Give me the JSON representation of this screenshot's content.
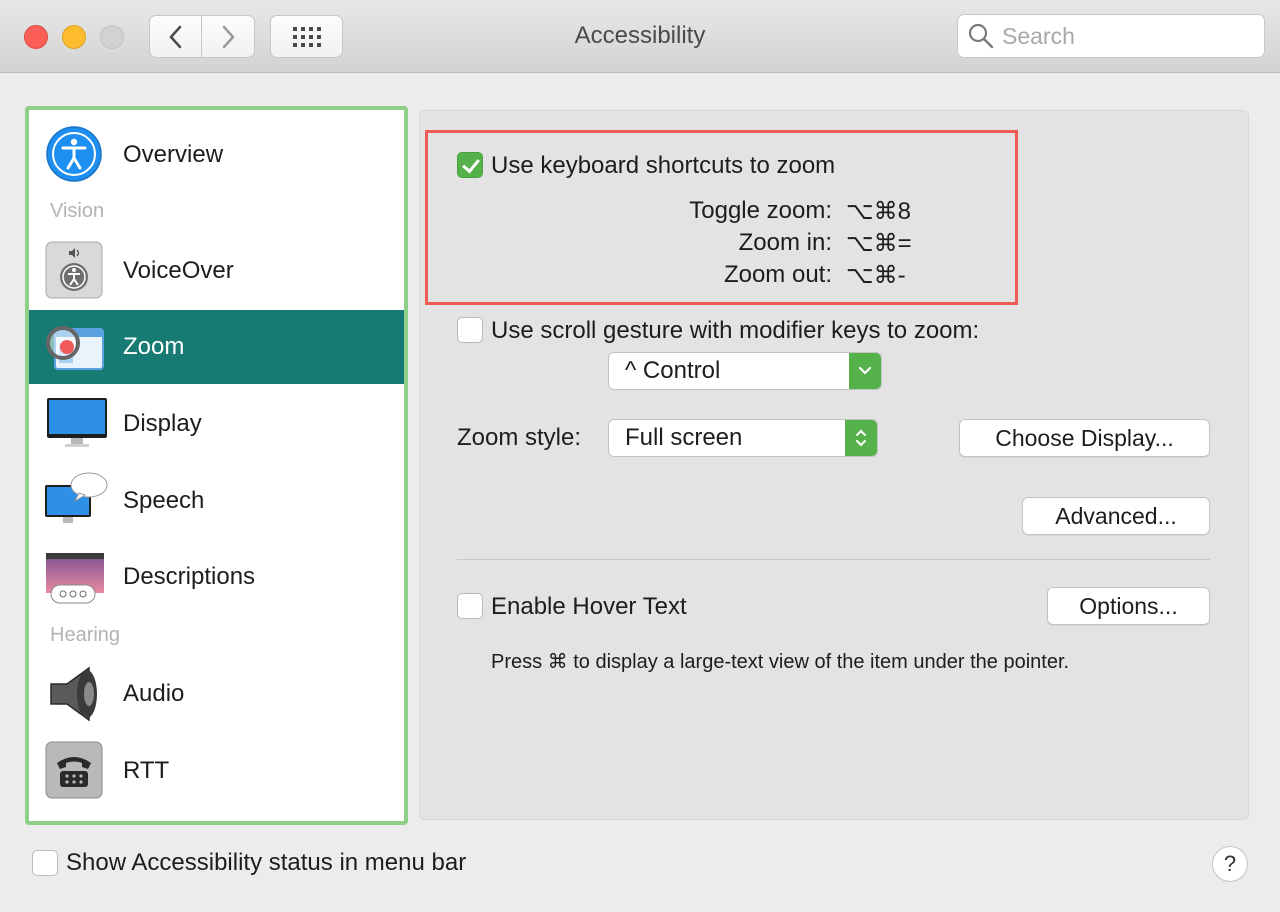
{
  "window": {
    "title": "Accessibility",
    "search_placeholder": "Search"
  },
  "sidebar": {
    "items": [
      {
        "label": "Overview",
        "icon": "accessibility-figure-icon"
      },
      {
        "label": "VoiceOver",
        "icon": "voiceover-icon"
      },
      {
        "label": "Zoom",
        "icon": "zoom-magnifier-icon",
        "selected": true
      },
      {
        "label": "Display",
        "icon": "monitor-icon"
      },
      {
        "label": "Speech",
        "icon": "speech-bubble-monitor-icon"
      },
      {
        "label": "Descriptions",
        "icon": "descriptions-icon"
      },
      {
        "label": "Audio",
        "icon": "speaker-icon"
      },
      {
        "label": "RTT",
        "icon": "telephone-icon"
      }
    ],
    "groups": {
      "vision": "Vision",
      "hearing": "Hearing"
    }
  },
  "zoom": {
    "keyboard_shortcuts_label": "Use keyboard shortcuts to zoom",
    "keyboard_shortcuts_checked": true,
    "shortcuts": [
      {
        "label": "Toggle zoom:",
        "keys": "⌥⌘8"
      },
      {
        "label": "Zoom in:",
        "keys": "⌥⌘="
      },
      {
        "label": "Zoom out:",
        "keys": "⌥⌘-"
      }
    ],
    "scroll_gesture_label": "Use scroll gesture with modifier keys to zoom:",
    "scroll_gesture_checked": false,
    "modifier_value": "^ Control",
    "zoom_style_label": "Zoom style:",
    "zoom_style_value": "Full screen",
    "choose_display_button": "Choose Display...",
    "advanced_button": "Advanced...",
    "hover_text_label": "Enable Hover Text",
    "hover_text_checked": false,
    "options_button": "Options...",
    "hover_hint": "Press ⌘ to display a large-text view of the item under the pointer."
  },
  "footer": {
    "status_menu_label": "Show Accessibility status in menu bar",
    "status_menu_checked": false,
    "help_label": "?"
  },
  "colors": {
    "selection": "#177a73",
    "accent_green": "#55b14a",
    "sidebar_border": "#8fd088",
    "highlight_red": "#ef5b55"
  }
}
